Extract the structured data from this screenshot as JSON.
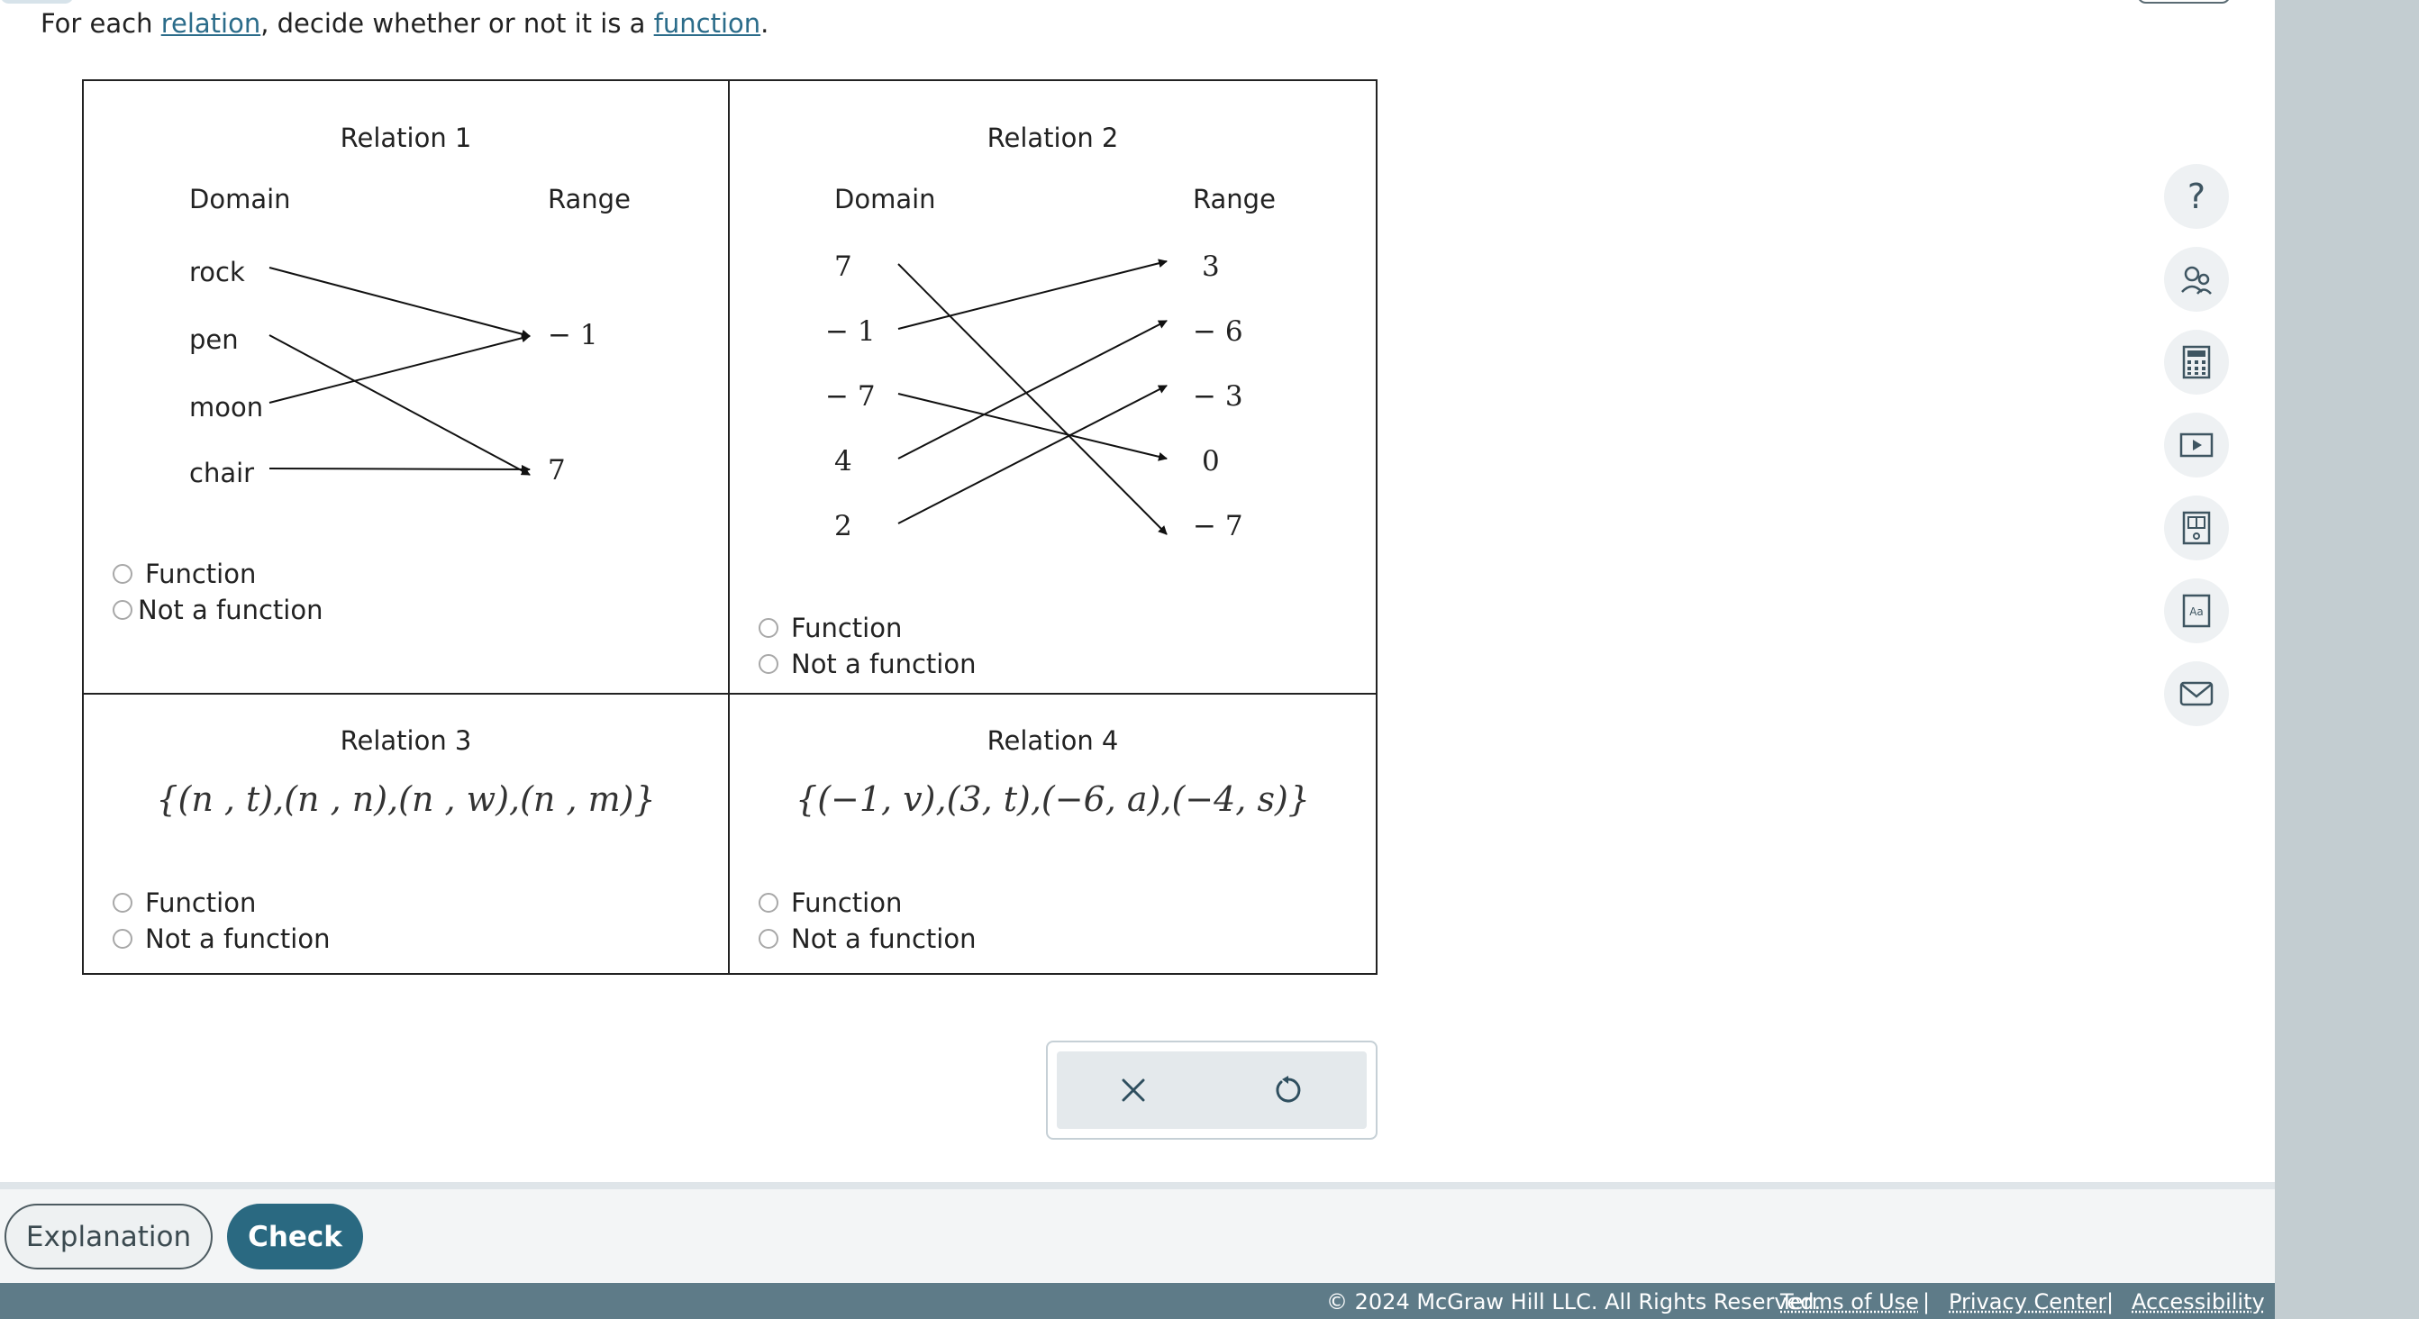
{
  "prompt": {
    "before": "For each ",
    "link1": "relation",
    "middle": ", decide whether or not it is a ",
    "link2": "function",
    "after": "."
  },
  "relation1": {
    "title": "Relation 1",
    "domain_label": "Domain",
    "range_label": "Range",
    "domain": [
      "rock",
      "pen",
      "moon",
      "chair"
    ],
    "range": [
      "− 1",
      "7"
    ],
    "mapping": [
      [
        "rock",
        "− 1"
      ],
      [
        "pen",
        "7"
      ],
      [
        "moon",
        "− 1"
      ],
      [
        "chair",
        "7"
      ]
    ],
    "options": [
      "Function",
      "Not a function"
    ]
  },
  "relation2": {
    "title": "Relation 2",
    "domain_label": "Domain",
    "range_label": "Range",
    "domain": [
      "7",
      "− 1",
      "− 7",
      "4",
      "2"
    ],
    "range": [
      "3",
      "− 6",
      "− 3",
      "0",
      "− 7"
    ],
    "mapping": [
      [
        "7",
        "− 7"
      ],
      [
        "− 1",
        "3"
      ],
      [
        "− 7",
        "0"
      ],
      [
        "4",
        "− 6"
      ],
      [
        "2",
        "− 3"
      ]
    ],
    "options": [
      "Function",
      "Not a function"
    ]
  },
  "relation3": {
    "title": "Relation 3",
    "set": "{(n , t),(n , n),(n , w),(n , m)}",
    "options": [
      "Function",
      "Not a function"
    ]
  },
  "relation4": {
    "title": "Relation 4",
    "set": "{(−1, v),(3, t),(−6, a),(−4, s)}",
    "options": [
      "Function",
      "Not a function"
    ]
  },
  "toolbox": {
    "clear_icon": "close-icon",
    "undo_icon": "undo-icon"
  },
  "sidebar": [
    "help-icon",
    "ask-instructor-icon",
    "calculator-icon",
    "video-icon",
    "ebook-icon",
    "glossary-icon",
    "message-icon"
  ],
  "buttons": {
    "explanation": "Explanation",
    "check": "Check"
  },
  "footer": {
    "copyright": "© 2024 McGraw Hill LLC. All Rights Reserved.",
    "terms": "Terms of Use",
    "privacy": "Privacy Center",
    "accessibility": "Accessibility",
    "separator": "|"
  },
  "colors": {
    "accent": "#2a6981",
    "footer": "#5e7b88",
    "gutter": "#c3cdd1",
    "link": "#2b6c8a"
  }
}
